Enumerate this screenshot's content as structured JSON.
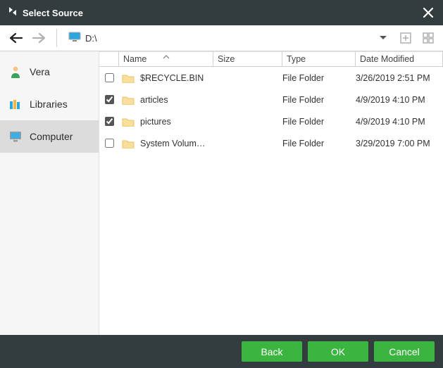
{
  "window": {
    "title": "Select Source"
  },
  "toolbar": {
    "path": "D:\\"
  },
  "sidebar": {
    "items": [
      {
        "label": "Vera"
      },
      {
        "label": "Libraries"
      },
      {
        "label": "Computer"
      }
    ]
  },
  "columns": {
    "name": "Name",
    "size": "Size",
    "type": "Type",
    "date": "Date Modified"
  },
  "rows": [
    {
      "checked": false,
      "name": "$RECYCLE.BIN",
      "size": "",
      "type": "File Folder",
      "date": "3/26/2019 2:51 PM"
    },
    {
      "checked": true,
      "name": "articles",
      "size": "",
      "type": "File Folder",
      "date": "4/9/2019 4:10 PM"
    },
    {
      "checked": true,
      "name": "pictures",
      "size": "",
      "type": "File Folder",
      "date": "4/9/2019 4:10 PM"
    },
    {
      "checked": false,
      "name": "System Volum…",
      "size": "",
      "type": "File Folder",
      "date": "3/29/2019 7:00 PM"
    }
  ],
  "footer": {
    "back": "Back",
    "ok": "OK",
    "cancel": "Cancel"
  }
}
